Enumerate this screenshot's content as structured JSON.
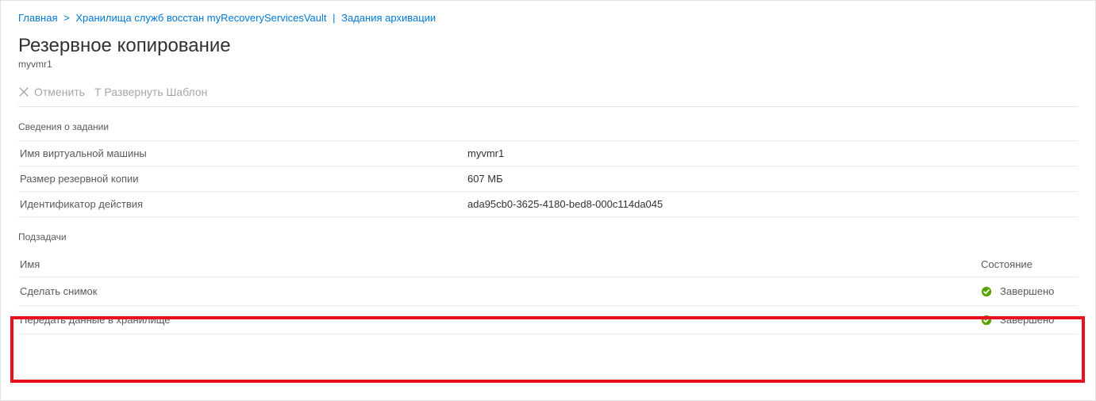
{
  "breadcrumb": {
    "home": "Главная",
    "vaults": "Хранилища служб восстан",
    "vault_name": "myRecoveryServicesVault",
    "current": "Задания архивации"
  },
  "header": {
    "title": "Резервное копирование",
    "subtitle": "myvmr1"
  },
  "toolbar": {
    "cancel": "Отменить",
    "deploy_template": "Т Развернуть Шаблон"
  },
  "sections": {
    "details_label": "Сведения о задании",
    "subtasks_label": "Подзадачи"
  },
  "details": {
    "rows": [
      {
        "key": "Имя виртуальной машины",
        "value": "myvmr1"
      },
      {
        "key": "Размер резервной копии",
        "value": "607 МБ"
      },
      {
        "key": "Идентификатор действия",
        "value": "ada95cb0-3625-4180-bed8-000c114da045"
      }
    ]
  },
  "subtasks": {
    "columns": [
      "Имя",
      "Состояние"
    ],
    "rows": [
      {
        "name": "Сделать снимок",
        "status": "Завершено",
        "status_icon": "success"
      },
      {
        "name": "Передать данные в хранилище",
        "status": "Завершено",
        "status_icon": "success"
      }
    ]
  },
  "colors": {
    "link": "#0078d4",
    "success": "#57A300",
    "highlight": "#e81123"
  }
}
